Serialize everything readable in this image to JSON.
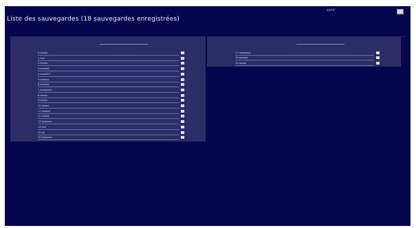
{
  "header": {
    "title": "Liste des sauvegardes (18 sauvegardes enregistrées)",
    "quit_label": "sortir",
    "corner_icon": "save-icon"
  },
  "scroll_hint": "« »",
  "left_panel": {
    "items": [
      {
        "label": "0.aaaaa"
      },
      {
        "label": "1.aaa"
      },
      {
        "label": "2.aaaaa"
      },
      {
        "label": "3.aaaaa0"
      },
      {
        "label": "4.aaaa001"
      },
      {
        "label": "5.aaaaaa"
      },
      {
        "label": "6.aaaaaa"
      },
      {
        "label": "7.aaaaaaaa"
      },
      {
        "label": "8.aaaaa"
      },
      {
        "label": "9.aaaaa"
      },
      {
        "label": "10.aaaaa"
      },
      {
        "label": "11.aaaaa0"
      },
      {
        "label": "12.aaaaa"
      },
      {
        "label": "13.aaaaaaa"
      },
      {
        "label": "14.aaa"
      },
      {
        "label": "15.aa"
      },
      {
        "label": "16.aaaaaaa"
      }
    ]
  },
  "right_panel": {
    "items": [
      {
        "label": "17.aaaaaaaa"
      },
      {
        "label": "18.aaaaaa"
      },
      {
        "label": "19.aaaaa"
      }
    ]
  },
  "colors": {
    "background": "#06064e",
    "panel": "#2c2c66",
    "text": "#d0d0f0"
  }
}
